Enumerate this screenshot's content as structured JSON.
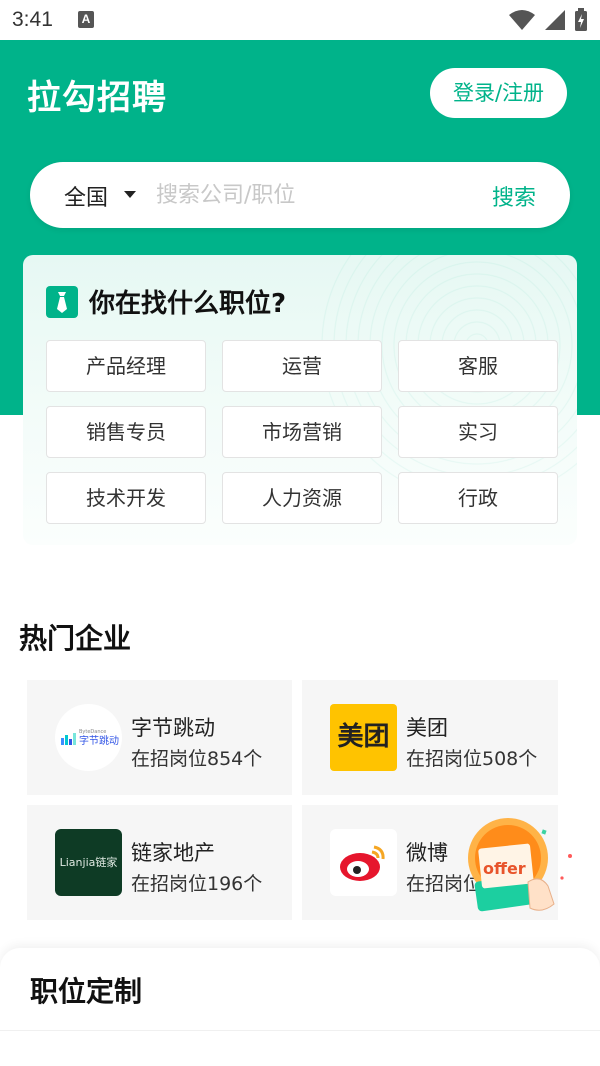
{
  "status_bar": {
    "time": "3:41",
    "notification_letter": "A"
  },
  "header": {
    "logo": "拉勾招聘",
    "login_button": "登录/注册"
  },
  "search": {
    "region": "全国",
    "placeholder": "搜索公司/职位",
    "button": "搜索"
  },
  "job_finder": {
    "title": "你在找什么职位?",
    "tags": [
      "产品经理",
      "运营",
      "客服",
      "销售专员",
      "市场营销",
      "实习",
      "技术开发",
      "人力资源",
      "行政"
    ]
  },
  "hot_companies": {
    "title": "热门企业",
    "items": [
      {
        "name": "字节跳动",
        "count": "在招岗位854个",
        "logo_text": "字节跳动",
        "logo_subtext": "ByteDance"
      },
      {
        "name": "美团",
        "count": "在招岗位508个",
        "logo_text": "美团"
      },
      {
        "name": "链家地产",
        "count": "在招岗位196个",
        "logo_text": "Lianjia链家"
      },
      {
        "name": "微博",
        "count": "在招岗位"
      }
    ]
  },
  "offer_badge": {
    "label": "offer"
  },
  "bottom_sheet": {
    "title": "职位定制"
  },
  "colors": {
    "brand": "#00b38a",
    "meituan": "#ffc300",
    "lianjia": "#0e3b25"
  }
}
